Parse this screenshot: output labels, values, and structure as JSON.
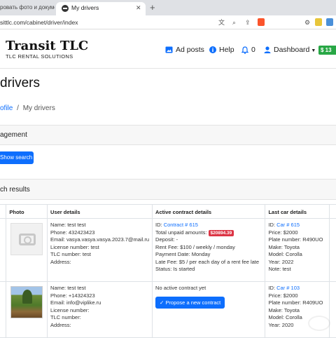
{
  "browser": {
    "prev_tab_title": "ровать фото и документ",
    "active_tab_title": "My drivers",
    "url": "sittlc.com/cabinet/driver/index"
  },
  "navbar": {
    "brand": "Transit TLC",
    "brand_sub": "TLC RENTAL SOLUTIONS",
    "ad_posts": "Ad posts",
    "help": "Help",
    "notifications_count": "0",
    "dashboard": "Dashboard",
    "cash": "$ 13"
  },
  "page": {
    "title": "drivers",
    "crumb_link": "ofile",
    "crumb_sep": "/",
    "crumb_current": "My drivers",
    "management_title": "agement",
    "show_search": "Show search",
    "results_title": "ch results"
  },
  "table": {
    "headers": [
      "Photo",
      "User details",
      "Active contract details",
      "Last car details"
    ],
    "rows": [
      {
        "photo": "placeholder",
        "user": {
          "name": "Name: test test",
          "phone": "Phone: 432423423",
          "email": "Email: vasya.vasya.vasya.2023.7@mail.ru",
          "license": "License number: test",
          "tlc": "TLC number: test",
          "address": "Address:"
        },
        "contract": {
          "id_label": "ID: ",
          "id_link": "Contract # 615",
          "unpaid_label": "Total unpaid amounts: ",
          "unpaid_badge": "$20894.39",
          "deposit": "Deposit: -",
          "rent_fee": "Rent Fee: $100 / weekly / monday",
          "payment_date": "Payment Date: Monday",
          "late_fee": "Late Fee: $5 / per each day of a rent fee late",
          "status": "Status: Is started"
        },
        "car": {
          "id_label": "ID: ",
          "id_link": "Car # 615",
          "price": "Price: $2000",
          "plate": "Plate number: R490UO",
          "make": "Make: Toyota",
          "model": "Model: Corolla",
          "year": "Year: 2022",
          "note": "Note: test"
        }
      },
      {
        "photo": "landscape",
        "user": {
          "name": "Name: test test",
          "phone": "Phone: +14324323",
          "email": "Email: info@viplike.ru",
          "license": "License number:",
          "tlc": "TLC number:",
          "address": "Address:"
        },
        "contract": {
          "none_text": "No active contract yet",
          "propose_button": "Propose a new contract"
        },
        "car": {
          "id_label": "ID: ",
          "id_link": "Car # 103",
          "price": "Price: $2000",
          "plate": "Plate number: R409UO",
          "make": "Make: Toyota",
          "model": "Model: Corolla",
          "year": "Year: 2020"
        }
      }
    ]
  },
  "colors": {
    "primary": "#0d6efd",
    "danger": "#dc3545",
    "success": "#28a745"
  }
}
